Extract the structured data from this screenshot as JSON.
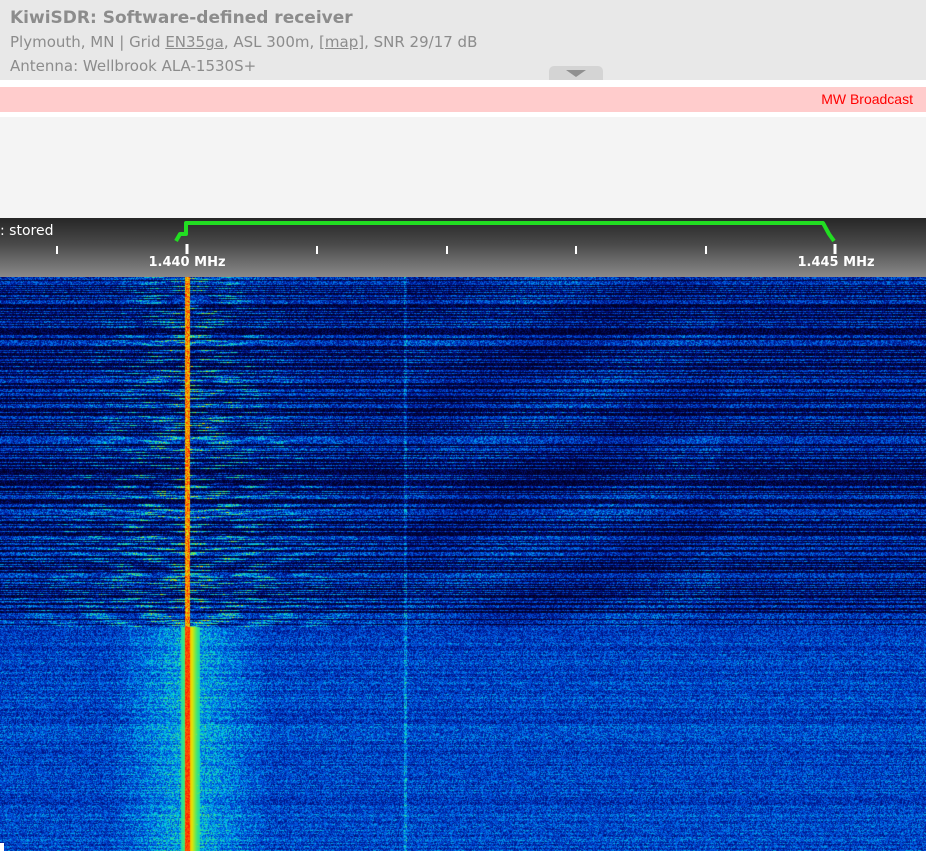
{
  "header": {
    "title": "KiwiSDR: Software-defined receiver",
    "location": "Plymouth, MN | Grid ",
    "grid": "EN35ga",
    "asl": ", ASL 300m, ",
    "map": "[map]",
    "snr": ", SNR 29/17 dB",
    "antenna": "Antenna: Wellbrook ALA-1530S+"
  },
  "band": {
    "label": "MW Broadcast"
  },
  "scale": {
    "mode_text": ": stored",
    "labels": [
      "1.440 MHz",
      "1.445 MHz"
    ]
  },
  "icons": {
    "collapse": "chevron-down-icon"
  },
  "colors": {
    "band_bar": "#ffcccc",
    "band_label": "#ff0000",
    "passband": "#22dd22",
    "waterfall_low": "#00003a",
    "waterfall_high": "#ff2000"
  }
}
